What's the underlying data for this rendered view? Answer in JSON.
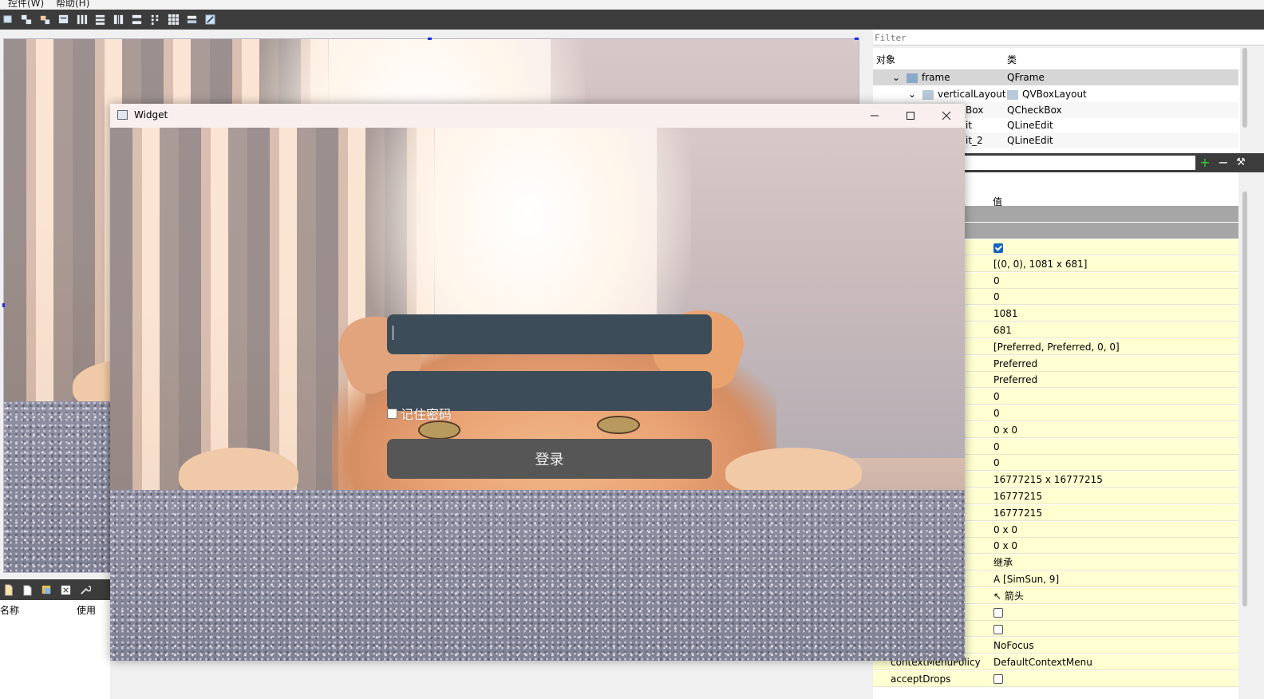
{
  "menubar": {
    "item1": "控件(W)",
    "item2": "帮助(H)"
  },
  "object_inspector": {
    "filter_placeholder": "Filter",
    "col_object": "对象",
    "col_class": "类",
    "rows": [
      {
        "name": "frame",
        "class": "QFrame"
      },
      {
        "name": "verticalLayout",
        "class": "QVBoxLayout"
      },
      {
        "name": "Box",
        "class": "QCheckBox"
      },
      {
        "name": "it",
        "class": "QLineEdit"
      },
      {
        "name": "it_2",
        "class": "QLineEdit"
      }
    ]
  },
  "property_editor": {
    "col_value": "值",
    "rows": [
      {
        "name": "",
        "value": ""
      },
      {
        "name": "",
        "value": "[(0, 0), 1081 x 681]"
      },
      {
        "name": "",
        "value": "0"
      },
      {
        "name": "",
        "value": "0"
      },
      {
        "name": "",
        "value": "1081"
      },
      {
        "name": "",
        "value": "681"
      },
      {
        "name": "",
        "value": "[Preferred, Preferred, 0, 0]"
      },
      {
        "name": "",
        "value": "Preferred"
      },
      {
        "name": "",
        "value": "Preferred"
      },
      {
        "name": "",
        "value": "0"
      },
      {
        "name": "",
        "value": "0"
      },
      {
        "name": "",
        "value": "0 x 0"
      },
      {
        "name": "",
        "value": "0"
      },
      {
        "name": "",
        "value": "0"
      },
      {
        "name": "",
        "value": "16777215 x 16777215"
      },
      {
        "name": "",
        "value": "16777215"
      },
      {
        "name": "",
        "value": "16777215"
      },
      {
        "name": "",
        "value": "0 x 0"
      },
      {
        "name": "",
        "value": "0 x 0"
      },
      {
        "name": "",
        "value": "继承"
      },
      {
        "name": "",
        "value": "[SimSun, 9]"
      },
      {
        "name": "",
        "value": "箭头"
      },
      {
        "name": "",
        "value": ""
      },
      {
        "name": "",
        "value": ""
      },
      {
        "name": "",
        "value": "NoFocus"
      },
      {
        "name": "contextMenuPolicy",
        "value": "DefaultContextMenu"
      },
      {
        "name": "acceptDrops",
        "value": ""
      }
    ]
  },
  "resource_panel": {
    "col_name": "名称",
    "col_use": "使用"
  },
  "preview_window": {
    "title": "Widget",
    "username_value": "",
    "password_value": "",
    "remember_label": "记住密码",
    "login_label": "登录"
  }
}
